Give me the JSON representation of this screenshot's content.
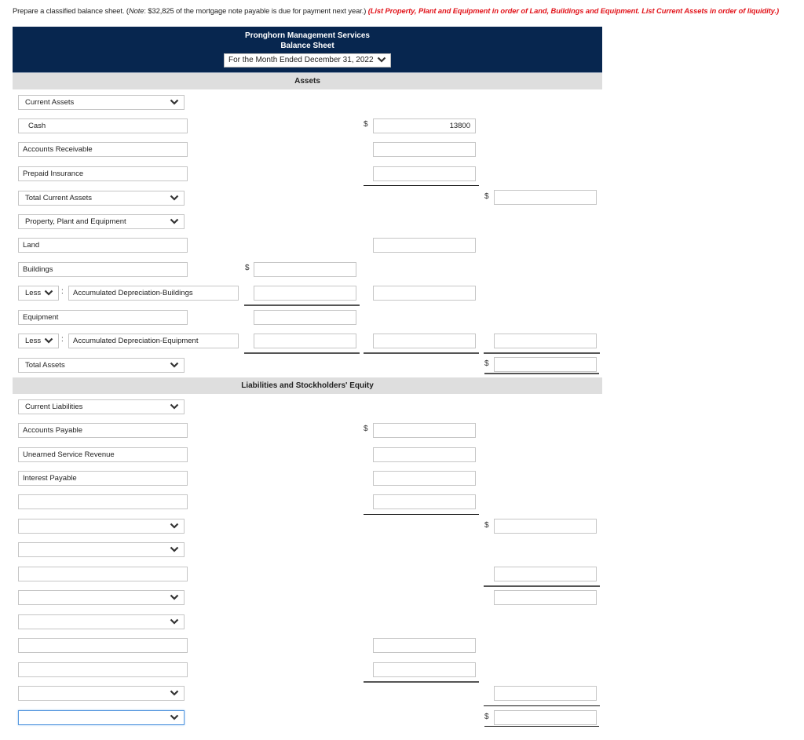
{
  "instructions": {
    "main": "Prepare a classified balance sheet. (",
    "note_label": "Note",
    "note_text": ": $32,825 of the mortgage note payable is due for payment next year.) ",
    "red_text": "(List Property, Plant and Equipment in order of Land, Buildings and Equipment. List Current Assets in order of liquidity.)"
  },
  "header": {
    "company": "Pronghorn Management Services",
    "statement": "Balance Sheet",
    "period": "For the Month Ended December 31, 2022"
  },
  "sections": {
    "assets": "Assets",
    "liabilities": "Liabilities and Stockholders' Equity"
  },
  "currency_symbol": "$",
  "rows": {
    "current_assets": "Current Assets",
    "cash": "Cash",
    "cash_amount": "13800",
    "accounts_receivable": "Accounts Receivable",
    "prepaid_insurance": "Prepaid Insurance",
    "total_current_assets": "Total Current Assets",
    "ppe": "Property, Plant and Equipment",
    "land": "Land",
    "buildings": "Buildings",
    "less": "Less",
    "acc_dep_buildings": "Accumulated Depreciation-Buildings",
    "equipment": "Equipment",
    "acc_dep_equipment": "Accumulated Depreciation-Equipment",
    "total_assets": "Total Assets",
    "current_liabilities": "Current Liabilities",
    "accounts_payable": "Accounts Payable",
    "unearned_service_revenue": "Unearned Service Revenue",
    "interest_payable": "Interest Payable",
    "colon": ":"
  },
  "colors": {
    "header_bg": "#07264f",
    "band_bg": "#dedede",
    "instruction_red": "#e2141b",
    "focus_blue": "#5b9be0"
  }
}
